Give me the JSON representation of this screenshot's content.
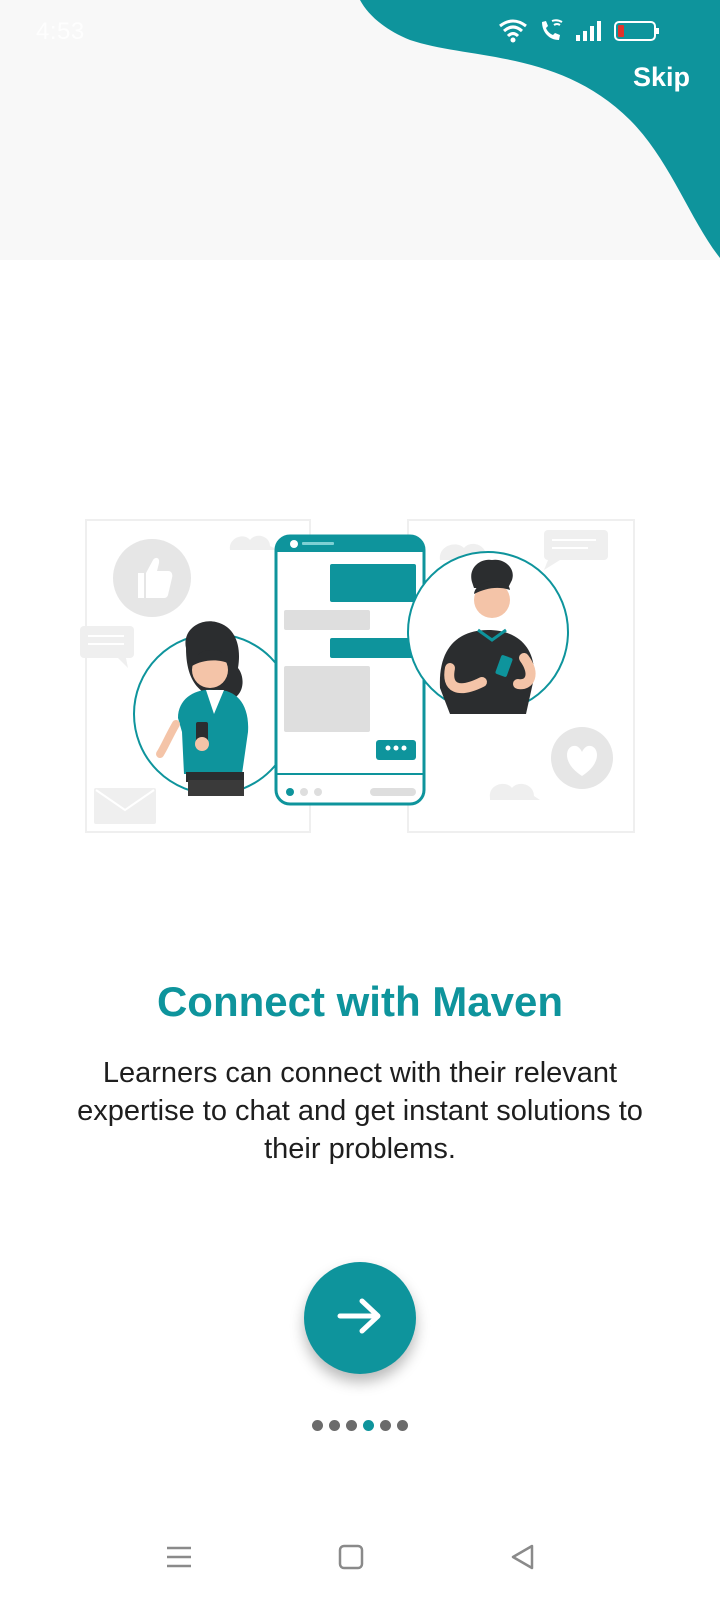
{
  "status_bar": {
    "time": "4:53",
    "icons": [
      "wifi-icon",
      "wifi-calling-icon",
      "signal-icon",
      "battery-low-icon"
    ]
  },
  "header": {
    "skip_label": "Skip"
  },
  "illustration": {
    "semantic": "two-people-chatting-phone-illustration"
  },
  "content": {
    "title": "Connect with Maven",
    "description": "Learners can connect with their relevant expertise to chat and get instant solutions to their problems."
  },
  "next_button": {
    "icon": "arrow-right-icon"
  },
  "pagination": {
    "total": 6,
    "active_index": 3
  },
  "nav_bar": {
    "icons": [
      "menu-icon",
      "home-square-icon",
      "back-triangle-icon"
    ]
  },
  "colors": {
    "accent": "#0e949c",
    "background": "#ffffff",
    "header_bg": "#f8f8f8",
    "text": "#1e1e1e"
  }
}
